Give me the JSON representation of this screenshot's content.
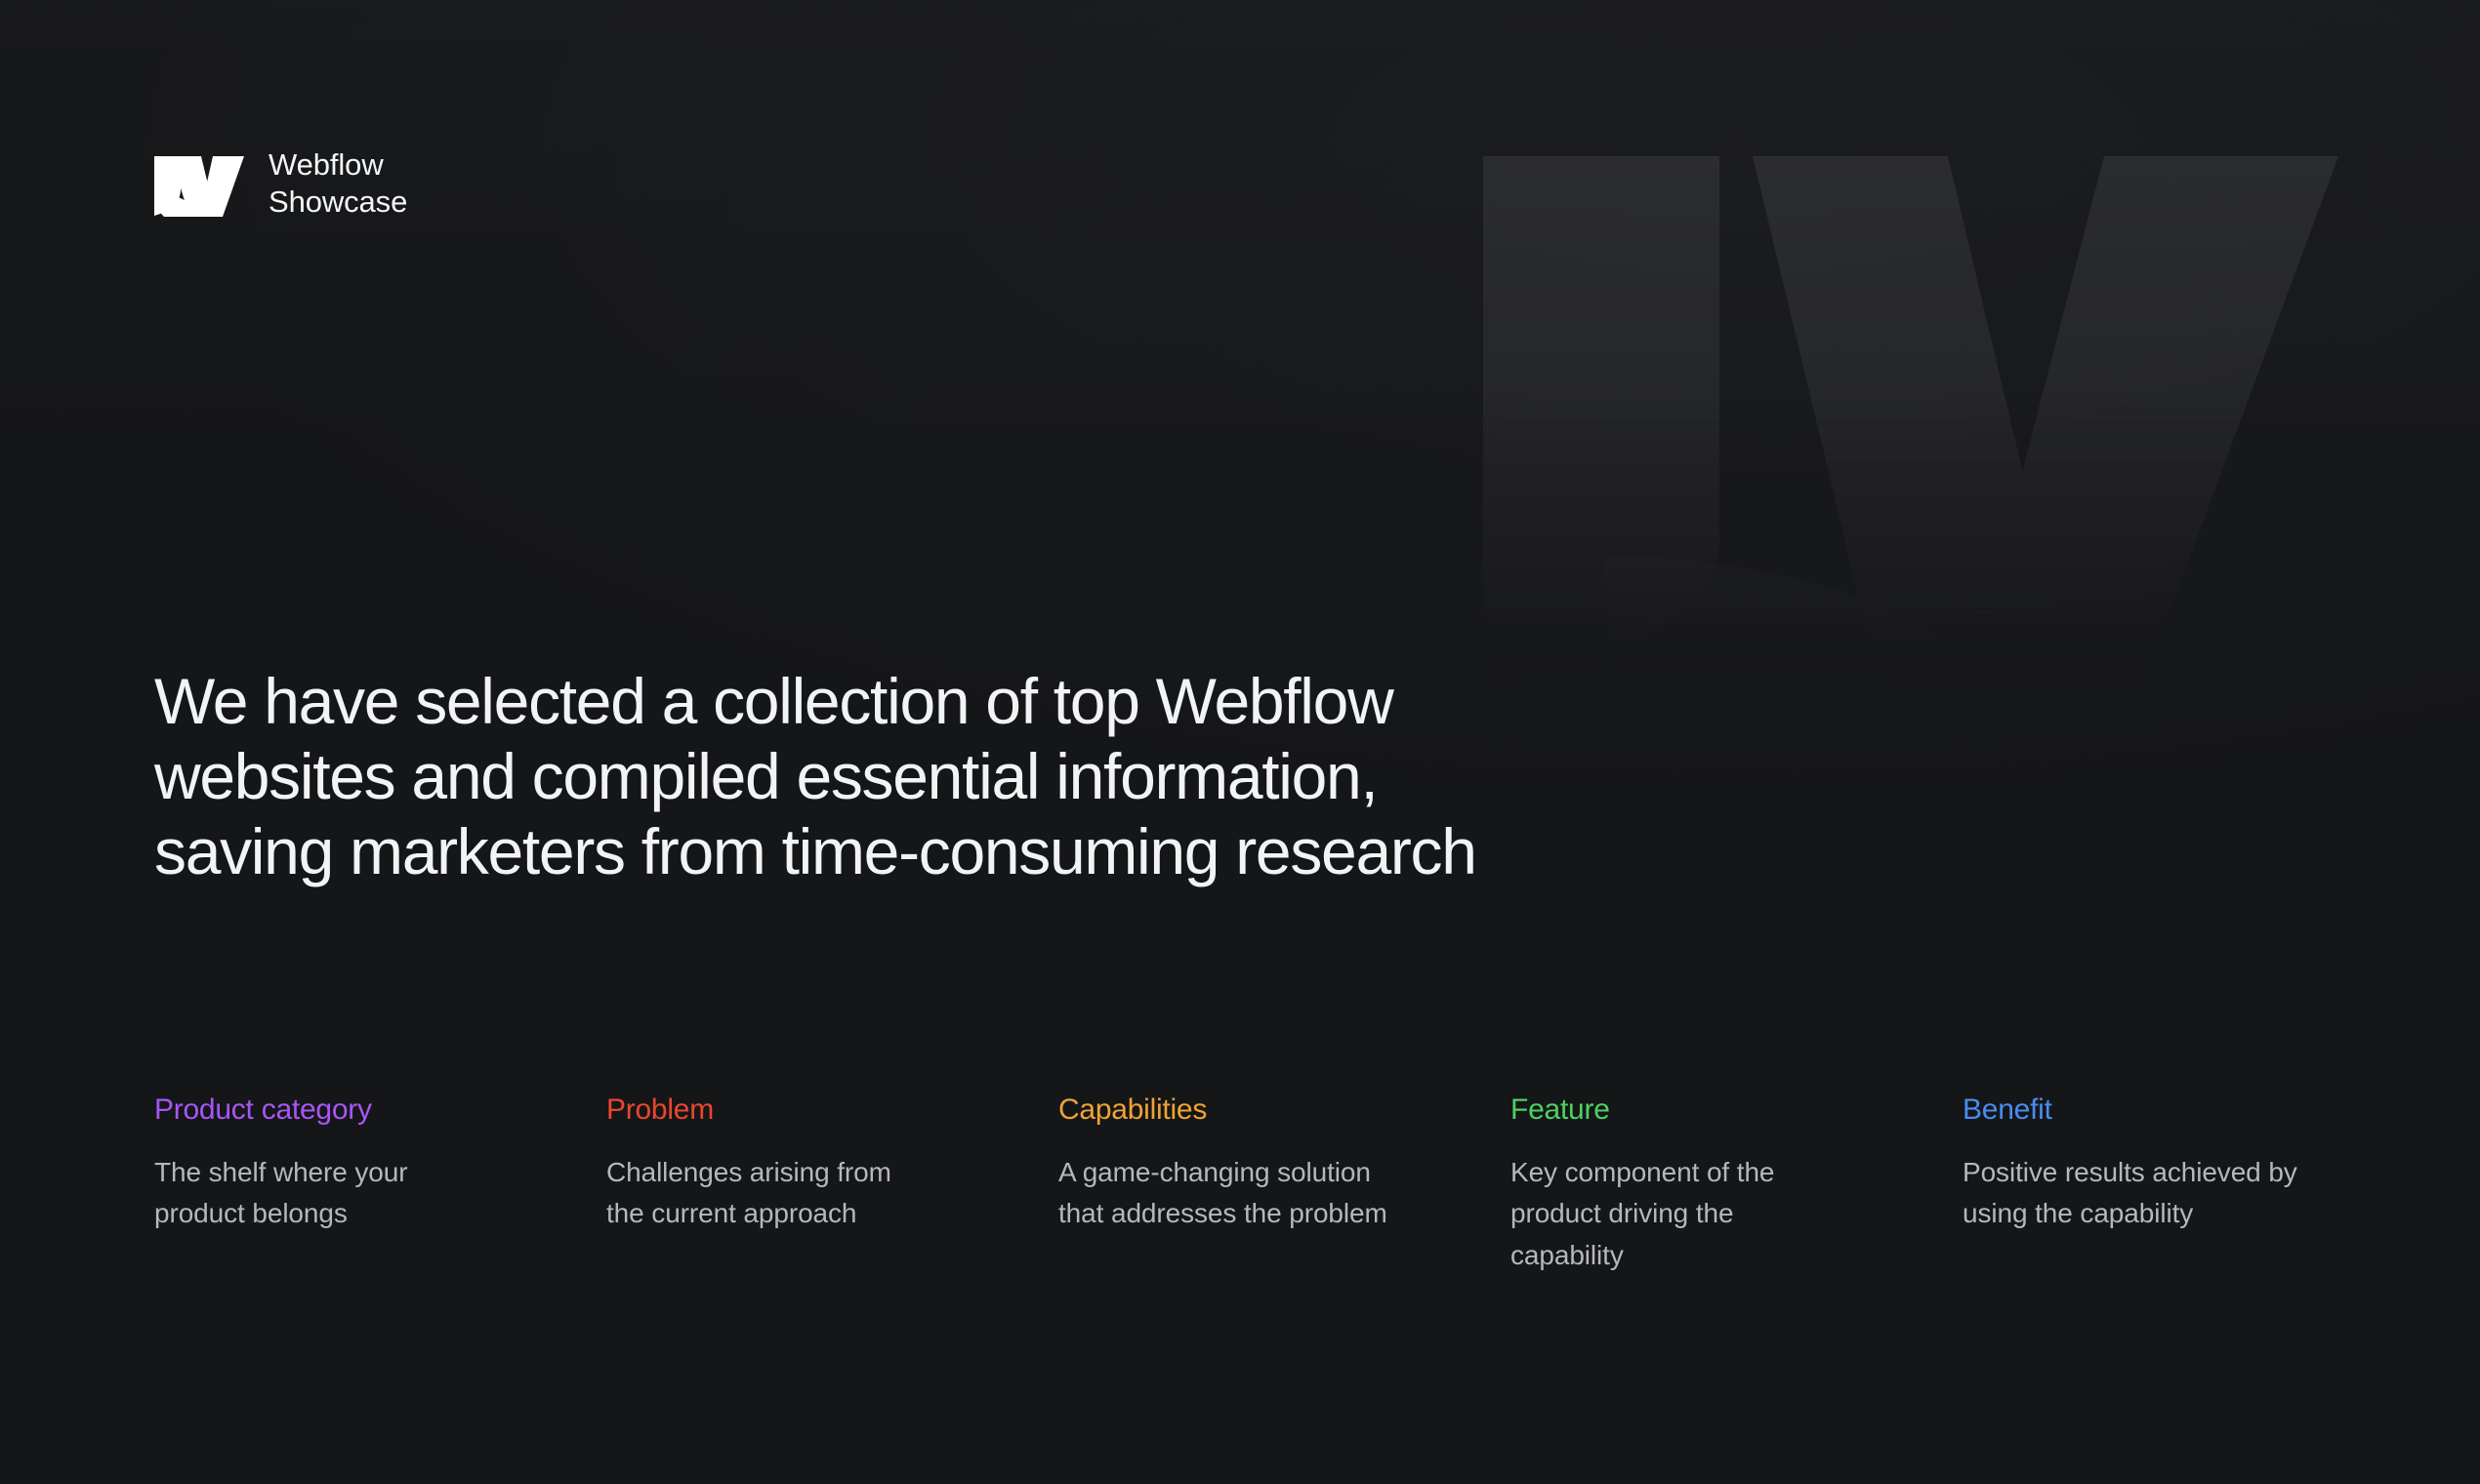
{
  "background_color": "#151618",
  "brand": {
    "mark_icon": "webflow-w-logo-icon",
    "line1": "Webflow",
    "line2": "Showcase"
  },
  "watermark": {
    "icon": "webflow-w-watermark-icon",
    "color": "#232427"
  },
  "headline": {
    "line1": "We have selected a collection of top Webflow",
    "line2": "websites and compiled essential information,",
    "line3": "saving marketers from time-consuming research",
    "color": "#f2f3f4"
  },
  "glossary": {
    "body_color": "#b5b7b9",
    "columns": [
      {
        "term": "Product category",
        "term_color": "#a855f7",
        "definition": "The shelf where your product belongs"
      },
      {
        "term": "Problem",
        "term_color": "#ea4630",
        "definition": "Challenges arising from the current approach"
      },
      {
        "term": "Capabilities",
        "term_color": "#f0a333",
        "definition": "A game-changing solution that addresses the problem"
      },
      {
        "term": "Feature",
        "term_color": "#4cd163",
        "definition": "Key component of the product driving the capability"
      },
      {
        "term": "Benefit",
        "term_color": "#4a8cf0",
        "definition": "Positive results achieved by using the capability"
      }
    ]
  }
}
